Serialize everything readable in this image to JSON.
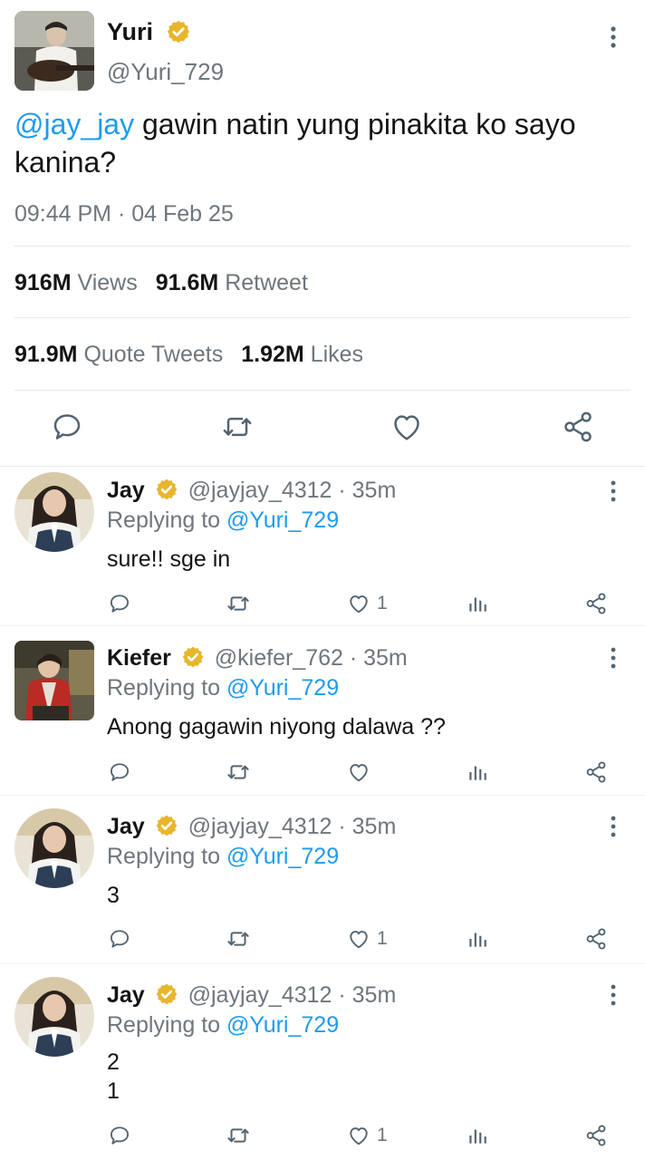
{
  "main_tweet": {
    "author_name": "Yuri",
    "author_handle": "@Yuri_729",
    "mention": "@jay_jay",
    "text": " gawin natin yung pinakita ko sayo kanina?",
    "timestamp": "09:44 PM · 04 Feb 25",
    "stats": {
      "views_count": "916M",
      "views_label": "Views",
      "retweet_count": "91.6M",
      "retweet_label": "Retweet",
      "quote_count": "91.9M",
      "quote_label": "Quote Tweets",
      "likes_count": "1.92M",
      "likes_label": "Likes"
    }
  },
  "replies": [
    {
      "name": "Jay",
      "handle_time": "@jayjay_4312 · 35m",
      "replying_prefix": "Replying to ",
      "replying_to": "@Yuri_729",
      "text": "sure!! sge in",
      "likes": "1"
    },
    {
      "name": "Kiefer",
      "handle_time": "@kiefer_762 · 35m",
      "replying_prefix": "Replying to ",
      "replying_to": "@Yuri_729",
      "text": "Anong gagawin niyong dalawa ??",
      "likes": ""
    },
    {
      "name": "Jay",
      "handle_time": "@jayjay_4312 · 35m",
      "replying_prefix": "Replying to ",
      "replying_to": "@Yuri_729",
      "text": "3",
      "likes": "1"
    },
    {
      "name": "Jay",
      "handle_time": "@jayjay_4312 · 35m",
      "replying_prefix": "Replying to ",
      "replying_to": "@Yuri_729",
      "text": "2\n1",
      "likes": "1"
    }
  ],
  "colors": {
    "accent": "#1d9bf0",
    "verified": "#e8b62c",
    "muted": "#6e767d",
    "text": "#141414"
  }
}
